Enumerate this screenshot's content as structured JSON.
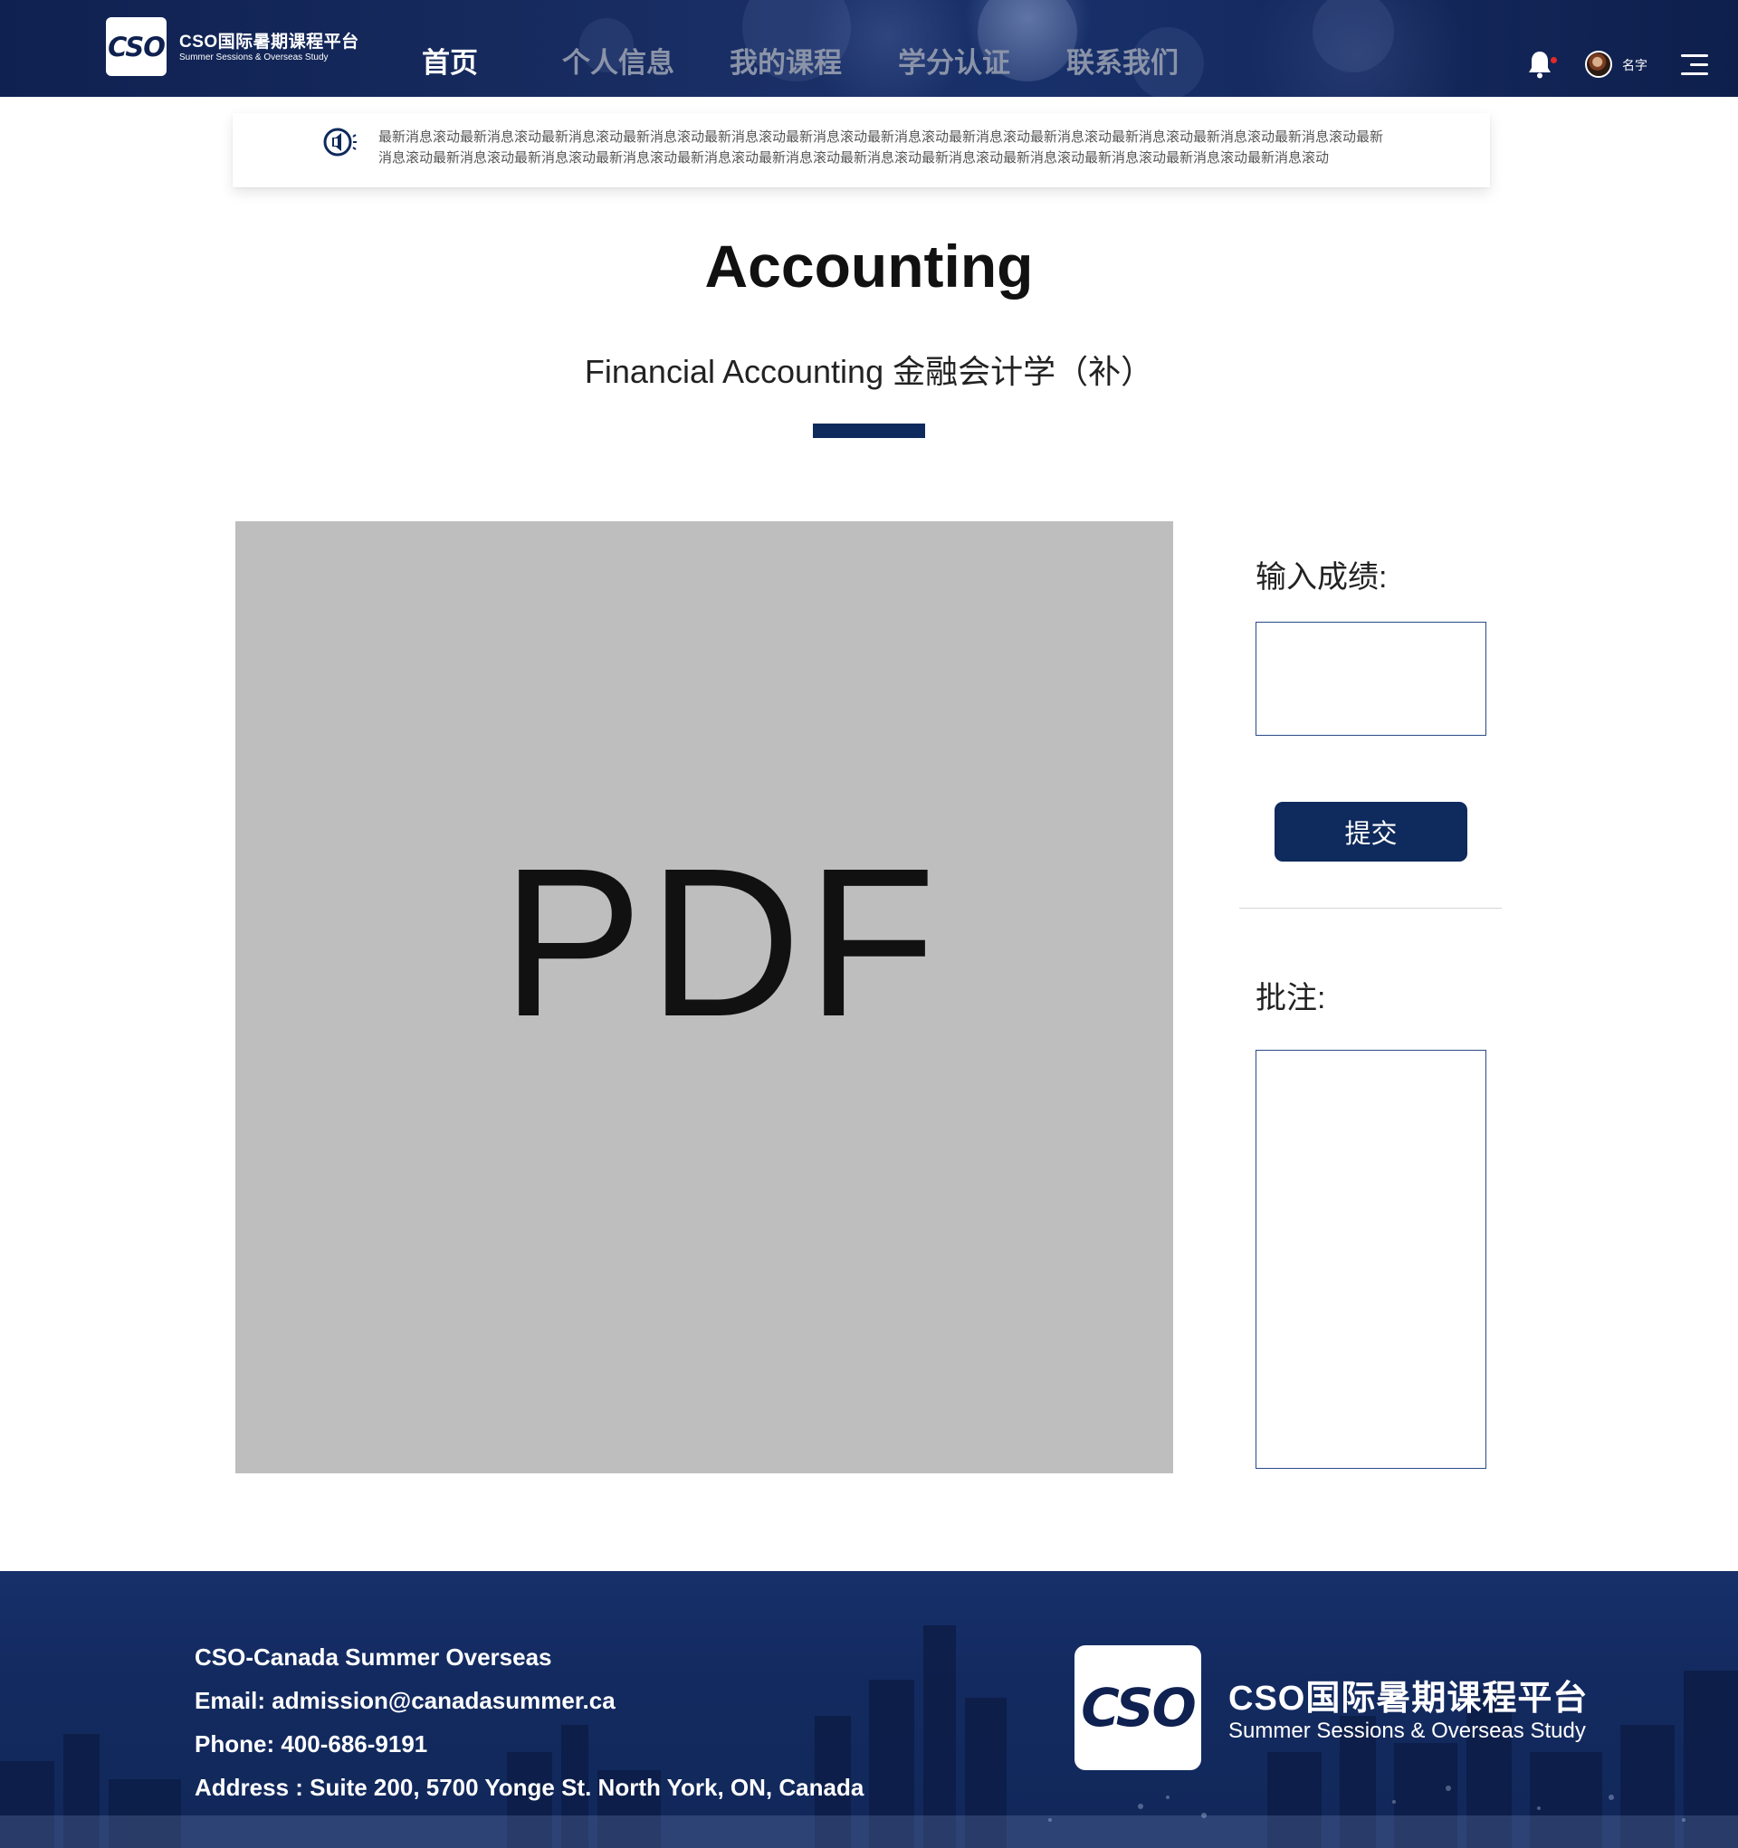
{
  "header": {
    "logo_mark": "CSO",
    "logo_cn": "CSO国际暑期课程平台",
    "logo_en": "Summer Sessions & Overseas Study",
    "nav": [
      {
        "label": "首页",
        "active": true
      },
      {
        "label": "个人信息",
        "active": false
      },
      {
        "label": "我的课程",
        "active": false
      },
      {
        "label": "学分认证",
        "active": false
      },
      {
        "label": "联系我们",
        "active": false
      }
    ],
    "user_name": "名字",
    "icons": [
      "bell-icon",
      "avatar",
      "menu-icon"
    ]
  },
  "notice": {
    "icon": "speaker-icon",
    "text": "最新消息滚动最新消息滚动最新消息滚动最新消息滚动最新消息滚动最新消息滚动最新消息滚动最新消息滚动最新消息滚动最新消息滚动最新消息滚动最新消息滚动最新消息滚动最新消息滚动最新消息滚动最新消息滚动最新消息滚动最新消息滚动最新消息滚动最新消息滚动最新消息滚动最新消息滚动最新消息滚动最新消息滚动"
  },
  "main": {
    "title": "Accounting",
    "subtitle": "Financial Accounting 金融会计学（补）",
    "pdf_placeholder": "PDF"
  },
  "panel": {
    "grade_label": "输入成绩:",
    "grade_value": "",
    "submit_label": "提交",
    "comment_label": "批注:",
    "comment_value": ""
  },
  "footer": {
    "company": "CSO-Canada Summer Overseas",
    "email": "Email: admission@canadasummer.ca",
    "phone": "Phone: 400-686-9191",
    "address": "Address : Suite 200, 5700 Yonge St. North York, ON, Canada",
    "logo_mark": "CSO",
    "logo_cn": "CSO国际暑期课程平台",
    "logo_en": "Summer Sessions & Overseas Study"
  },
  "colors": {
    "brand_navy": "#0f2a5c",
    "header_bg": "#132a62",
    "nav_inactive": "#8a93a8",
    "pdf_bg": "#bebebe",
    "notify_dot": "#e02a2a"
  }
}
